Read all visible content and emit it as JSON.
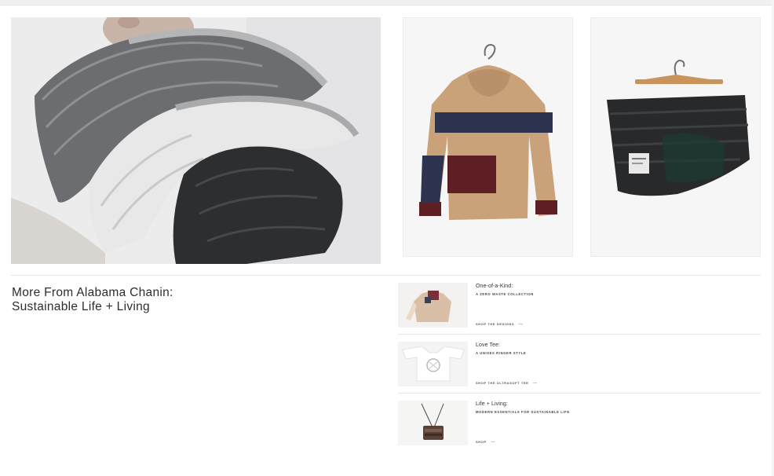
{
  "section": {
    "title_line1": "More From Alabama Chanin:",
    "title_line2": "Sustainable Life + Living"
  },
  "promos": [
    {
      "heading": "One-of-a-Kind:",
      "subtitle": "A ZERO WASTE COLLECTION",
      "cta": "SHOP THE DESIGNS",
      "arrow": "⟶"
    },
    {
      "heading": "Love Tee:",
      "subtitle": "A UNISEX RINGER STYLE",
      "cta": "SHOP THE ULTRASOFT TEE",
      "arrow": "⟶"
    },
    {
      "heading": "Life + Living:",
      "subtitle": "MODERN ESSENTIALS FOR SUSTAINABLE LIFE",
      "cta": "SHOP",
      "arrow": "⟶"
    }
  ],
  "colors": {
    "text": "#2d2d2d",
    "divider": "#e3e3e3",
    "camel": "#c9a27a",
    "navy": "#2e3350",
    "burgundy": "#5e1f24",
    "puffer_dark": "#2b2d2e"
  }
}
